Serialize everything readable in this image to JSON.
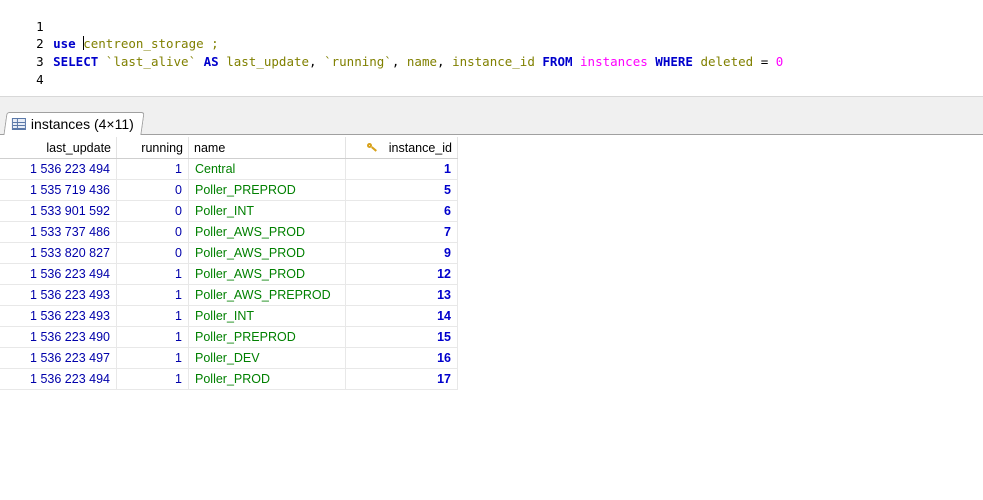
{
  "editor": {
    "line_numbers": [
      "1",
      "2",
      "3",
      "4"
    ],
    "line2": {
      "kw_use": "use",
      "db": "centreon_storage",
      "end": " ;"
    },
    "line3": {
      "kw_select": "SELECT",
      "col1": "`last_alive`",
      "kw_as": "AS",
      "alias1": "last_update",
      "comma1": ",",
      "col2": "`running`",
      "comma2": ",",
      "col3": "name",
      "comma3": ",",
      "col4": "instance_id",
      "kw_from": "FROM",
      "table": "instances",
      "kw_where": "WHERE",
      "cond_col": "deleted",
      "op": "=",
      "value": "0"
    }
  },
  "result_tab": {
    "label": "instances (4×11)",
    "icon": "table-icon"
  },
  "grid": {
    "columns": [
      "last_update",
      "running",
      "name",
      "instance_id"
    ],
    "rows": [
      [
        "1 536 223 494",
        "1",
        "Central",
        "1"
      ],
      [
        "1 535 719 436",
        "0",
        "Poller_PREPROD",
        "5"
      ],
      [
        "1 533 901 592",
        "0",
        "Poller_INT",
        "6"
      ],
      [
        "1 533 737 486",
        "0",
        "Poller_AWS_PROD",
        "7"
      ],
      [
        "1 533 820 827",
        "0",
        "Poller_AWS_PROD",
        "9"
      ],
      [
        "1 536 223 494",
        "1",
        "Poller_AWS_PROD",
        "12"
      ],
      [
        "1 536 223 493",
        "1",
        "Poller_AWS_PREPROD",
        "13"
      ],
      [
        "1 536 223 493",
        "1",
        "Poller_INT",
        "14"
      ],
      [
        "1 536 223 490",
        "1",
        "Poller_PREPROD",
        "15"
      ],
      [
        "1 536 223 497",
        "1",
        "Poller_DEV",
        "16"
      ],
      [
        "1 536 223 494",
        "1",
        "Poller_PROD",
        "17"
      ]
    ]
  },
  "colors": {
    "keyword": "#0000cc",
    "identifier": "#808000",
    "backtick_ident": "#008000",
    "number_literal": "#ff00ff",
    "grid_number": "#0000aa",
    "grid_text": "#008000"
  }
}
